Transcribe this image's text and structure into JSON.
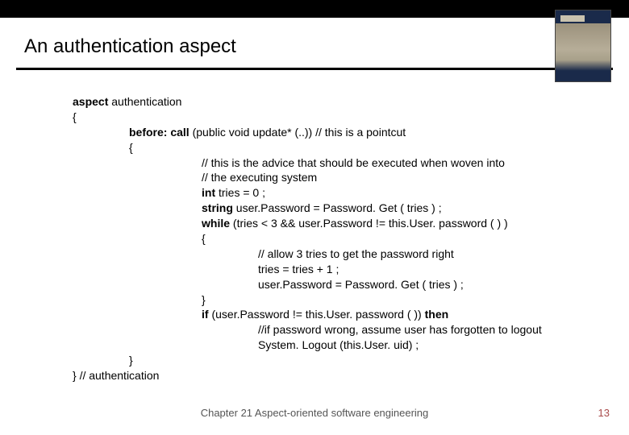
{
  "title": "An authentication aspect",
  "code": {
    "l1a": "aspect",
    "l1b": " authentication",
    "l2": "{",
    "l3a": "before: call ",
    "l3b": "(public void update* (..))   // this is a pointcut",
    "l4": "{",
    "l5": "// this is the advice that should be executed when woven into",
    "l6": "// the executing system",
    "l7a": "int ",
    "l7b": "tries = 0 ;",
    "l8a": "string ",
    "l8b": "user.Password = Password. Get ( tries ) ;",
    "l9a": "while ",
    "l9b": "(tries < 3 && user.Password != this.User. password ( ) )",
    "l10": "{",
    "l11": "// allow 3 tries to get the password right",
    "l12": "tries = tries + 1 ;",
    "l13": "user.Password = Password. Get ( tries ) ;",
    "l14": "}",
    "l15a": "if ",
    "l15b": "(user.Password != this.User. password ( ))",
    "l15c": " then",
    "l16": "//if password wrong, assume user has forgotten to logout",
    "l17": "System. Logout (this.User. uid) ;",
    "l18": "}",
    "l19": "} // authentication"
  },
  "footer": "Chapter 21 Aspect-oriented software engineering",
  "page": "13"
}
